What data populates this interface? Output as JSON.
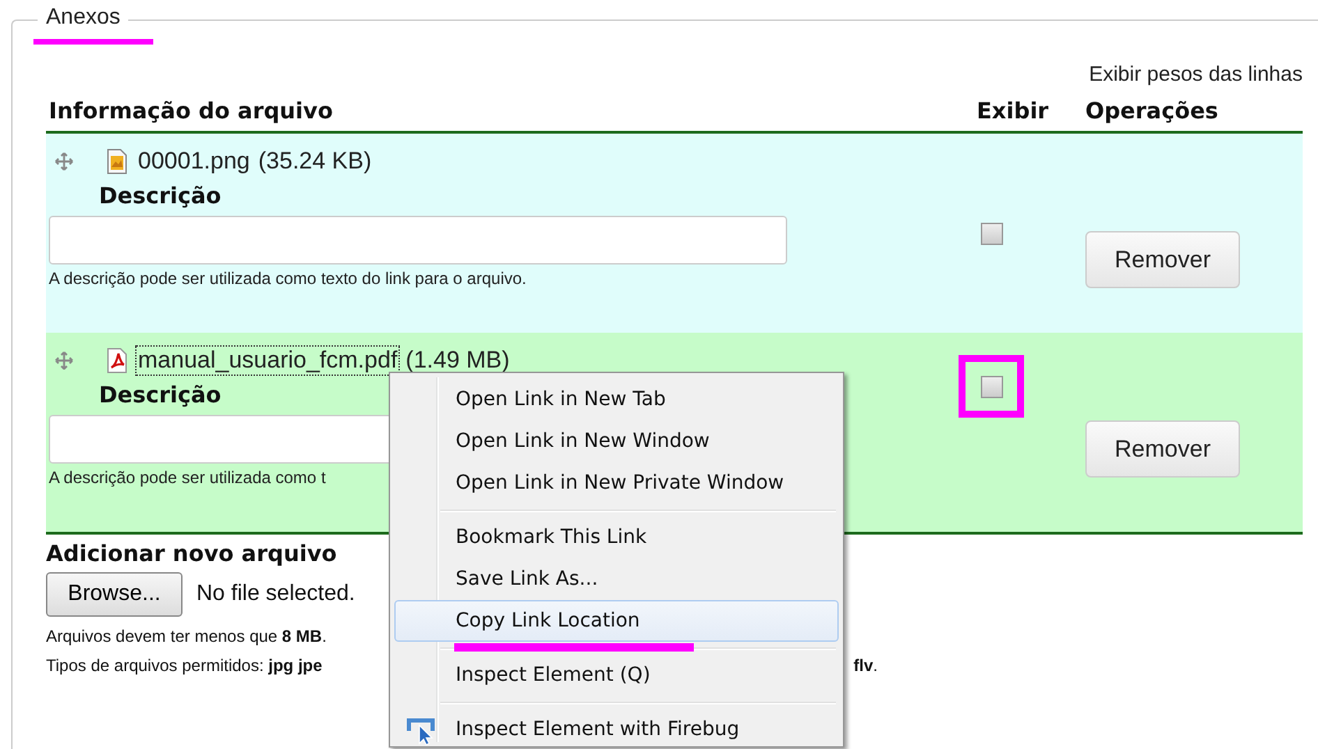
{
  "fieldset": {
    "legend": "Anexos",
    "highlighted": true
  },
  "weights_link": "Exibir pesos das linhas",
  "table": {
    "columns": [
      "Informação do arquivo",
      "Exibir",
      "Operações"
    ],
    "rows": [
      {
        "kind": "image",
        "file_name": "00001.png",
        "size": "(35.24 KB)",
        "focused": false,
        "description_label": "Descrição",
        "hint": "A descrição pode ser utilizada como texto do link para o arquivo.",
        "checked": false,
        "highlighted": false,
        "button": "Remover"
      },
      {
        "kind": "pdf",
        "file_name": "manual_usuario_fcm.pdf",
        "size": "(1.49 MB)",
        "focused": true,
        "description_label": "Descrição",
        "hint": "A descrição pode ser utilizada como t",
        "checked": false,
        "highlighted": true,
        "button": "Remover"
      }
    ]
  },
  "add": {
    "title": "Adicionar novo arquivo",
    "browse": "Browse...",
    "status": "No file selected.",
    "size_note": "Arquivos devem ter menos que **8 MB**.",
    "types_note": "Tipos de arquivos permitidos: **jpg jpe**",
    "types_note_end": "**flv**."
  },
  "context_menu": {
    "items": [
      {
        "kind": "item",
        "label": "Open Link in New Tab",
        "selected": false,
        "highlighted": false
      },
      {
        "kind": "item",
        "label": "Open Link in New Window",
        "selected": false,
        "highlighted": false
      },
      {
        "kind": "item",
        "label": "Open Link in New Private Window",
        "selected": false,
        "highlighted": false
      },
      {
        "kind": "separator"
      },
      {
        "kind": "item",
        "label": "Bookmark This Link",
        "selected": false,
        "highlighted": false
      },
      {
        "kind": "item",
        "label": "Save Link As...",
        "selected": false,
        "highlighted": false
      },
      {
        "kind": "item",
        "label": "Copy Link Location",
        "selected": true,
        "highlighted": true
      },
      {
        "kind": "separator"
      },
      {
        "kind": "item",
        "label": "Inspect Element (Q)",
        "selected": false,
        "highlighted": false
      },
      {
        "kind": "separator"
      },
      {
        "kind": "icon_item",
        "label": "Inspect Element with Firebug",
        "selected": false,
        "highlighted": false
      }
    ]
  }
}
